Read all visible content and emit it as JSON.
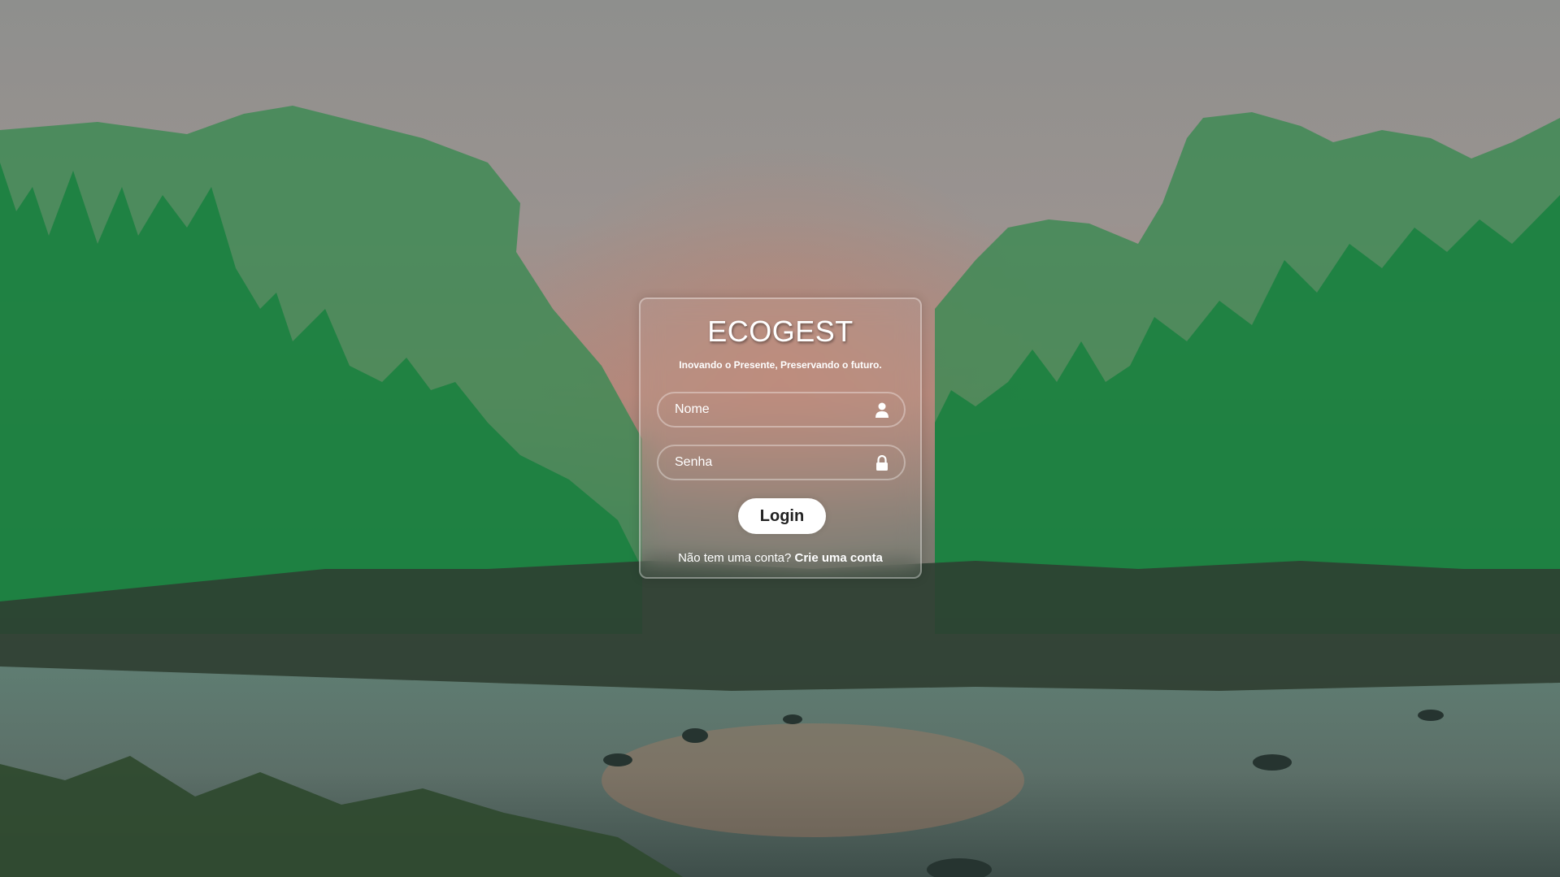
{
  "login": {
    "title": "ECOGEST",
    "subtitle": "Inovando o Presente, Preservando o futuro.",
    "name_placeholder": "Nome",
    "password_placeholder": "Senha",
    "login_label": "Login",
    "register_prompt": "Não tem uma conta?",
    "register_link": "Crie uma conta"
  },
  "icons": {
    "name_field": "user-icon",
    "password_field": "lock-icon"
  },
  "colors": {
    "text": "#ffffff",
    "button_bg": "#ffffff",
    "button_text": "#222222"
  }
}
